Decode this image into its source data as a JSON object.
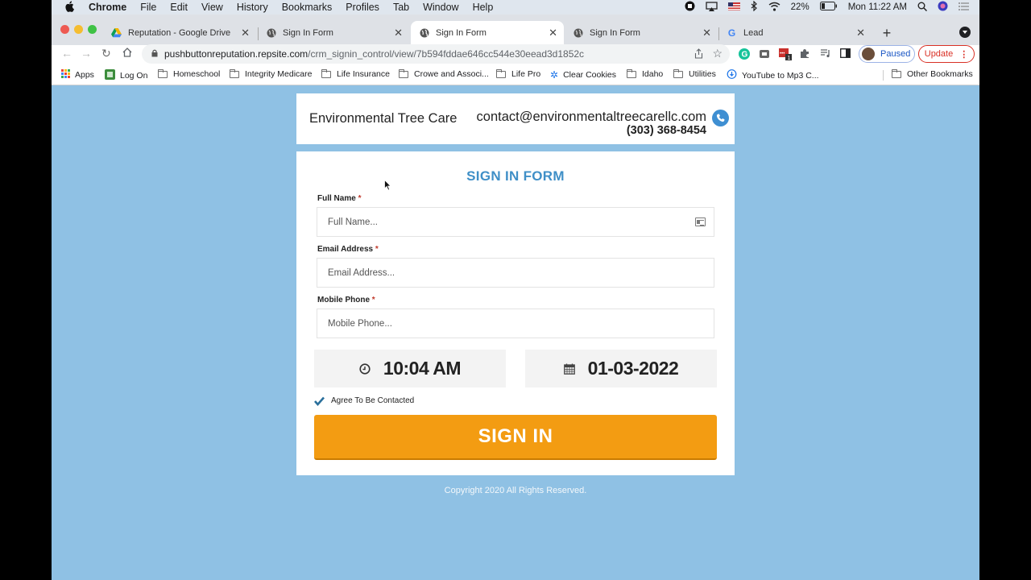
{
  "menubar": {
    "app": "Chrome",
    "items": [
      "File",
      "Edit",
      "View",
      "History",
      "Bookmarks",
      "Profiles",
      "Tab",
      "Window",
      "Help"
    ],
    "battery": "22%",
    "clock": "Mon 11:22 AM"
  },
  "tabs": [
    {
      "title": "Reputation - Google Drive",
      "icon": "google-drive-icon",
      "active": false
    },
    {
      "title": "Sign In Form",
      "icon": "globe-icon",
      "active": false
    },
    {
      "title": "Sign In Form",
      "icon": "globe-icon",
      "active": true
    },
    {
      "title": "Sign In Form",
      "icon": "globe-icon",
      "active": false
    },
    {
      "title": "Lead",
      "icon": "google-icon",
      "active": false
    }
  ],
  "toolbar": {
    "url_host": "pushbuttonreputation.repsite.com",
    "url_path": "/crm_signin_control/view/7b594fddae646cc544e30eead3d1852c",
    "profile_label": "Paused",
    "update_label": "Update",
    "extension_badge": "1"
  },
  "bookmarks": [
    {
      "label": "Apps",
      "icon": "apps-grid-icon"
    },
    {
      "label": "Log On",
      "icon": "logon-icon"
    },
    {
      "label": "Homeschool",
      "icon": "folder-icon"
    },
    {
      "label": "Integrity Medicare",
      "icon": "folder-icon"
    },
    {
      "label": "Life Insurance",
      "icon": "folder-icon"
    },
    {
      "label": "Crowe and Associ...",
      "icon": "folder-icon"
    },
    {
      "label": "Life Pro",
      "icon": "folder-icon"
    },
    {
      "label": "Clear Cookies",
      "icon": "gear-icon"
    },
    {
      "label": "Idaho",
      "icon": "folder-icon"
    },
    {
      "label": "Utilities",
      "icon": "folder-icon"
    },
    {
      "label": "YouTube to Mp3 C...",
      "icon": "download-cloud-icon"
    },
    {
      "label": "Other Bookmarks",
      "icon": "folder-icon"
    }
  ],
  "header": {
    "company": "Environmental Tree Care",
    "email": "contact@environmentaltreecarellc.com",
    "phone": "(303) 368-8454"
  },
  "form": {
    "title": "SIGN IN FORM",
    "required_mark": "*",
    "fields": [
      {
        "label": "Full Name",
        "placeholder": "Full Name...",
        "value": ""
      },
      {
        "label": "Email Address",
        "placeholder": "Email Address...",
        "value": ""
      },
      {
        "label": "Mobile Phone",
        "placeholder": "Mobile Phone...",
        "value": ""
      }
    ],
    "time": "10:04 AM",
    "date": "01-03-2022",
    "agree_label": "Agree To Be Contacted",
    "agree_checked": true,
    "submit_label": "SIGN IN"
  },
  "footer": {
    "copyright": "Copyright 2020 All Rights Reserved."
  },
  "colors": {
    "page_bg": "#8fc1e4",
    "title_blue": "#3f8fc7",
    "button_orange": "#f39c12",
    "required_red": "#c0392b"
  }
}
